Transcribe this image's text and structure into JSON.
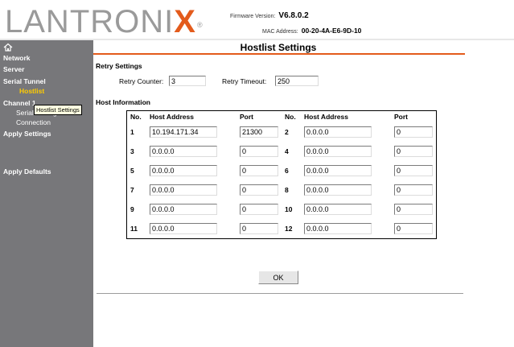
{
  "header": {
    "logo_text": "LANTRONIX",
    "firmware_label": "Firmware Version:",
    "firmware_value": "V6.8.0.2",
    "mac_label": "MAC Address:",
    "mac_value": "00-20-4A-E6-9D-10"
  },
  "sidebar": {
    "home_icon": "home-icon",
    "items": [
      {
        "label": "Network"
      },
      {
        "label": "Server"
      },
      {
        "label": "Serial Tunnel"
      },
      {
        "label": "Hostlist"
      },
      {
        "label": "Channel 1"
      },
      {
        "label": "Serial Settings"
      },
      {
        "label": "Connection"
      },
      {
        "label": "Apply Settings"
      },
      {
        "label": "Apply Defaults"
      }
    ],
    "tooltip": "Hostlist Settings"
  },
  "page": {
    "title": "Hostlist Settings",
    "retry": {
      "section_label": "Retry Settings",
      "counter_label": "Retry Counter:",
      "counter_value": "3",
      "timeout_label": "Retry Timeout:",
      "timeout_value": "250"
    },
    "host_info_label": "Host Information",
    "table_headers": [
      "No.",
      "Host Address",
      "Port",
      "No.",
      "Host Address",
      "Port"
    ],
    "hosts": [
      {
        "no": "1",
        "address": "10.194.171.34",
        "port": "21300"
      },
      {
        "no": "2",
        "address": "0.0.0.0",
        "port": "0"
      },
      {
        "no": "3",
        "address": "0.0.0.0",
        "port": "0"
      },
      {
        "no": "4",
        "address": "0.0.0.0",
        "port": "0"
      },
      {
        "no": "5",
        "address": "0.0.0.0",
        "port": "0"
      },
      {
        "no": "6",
        "address": "0.0.0.0",
        "port": "0"
      },
      {
        "no": "7",
        "address": "0.0.0.0",
        "port": "0"
      },
      {
        "no": "8",
        "address": "0.0.0.0",
        "port": "0"
      },
      {
        "no": "9",
        "address": "0.0.0.0",
        "port": "0"
      },
      {
        "no": "10",
        "address": "0.0.0.0",
        "port": "0"
      },
      {
        "no": "11",
        "address": "0.0.0.0",
        "port": "0"
      },
      {
        "no": "12",
        "address": "0.0.0.0",
        "port": "0"
      }
    ],
    "ok_label": "OK"
  },
  "colors": {
    "sidebar_bg": "#77777a",
    "accent": "#e35b1c",
    "active_nav": "#ffcc00"
  }
}
